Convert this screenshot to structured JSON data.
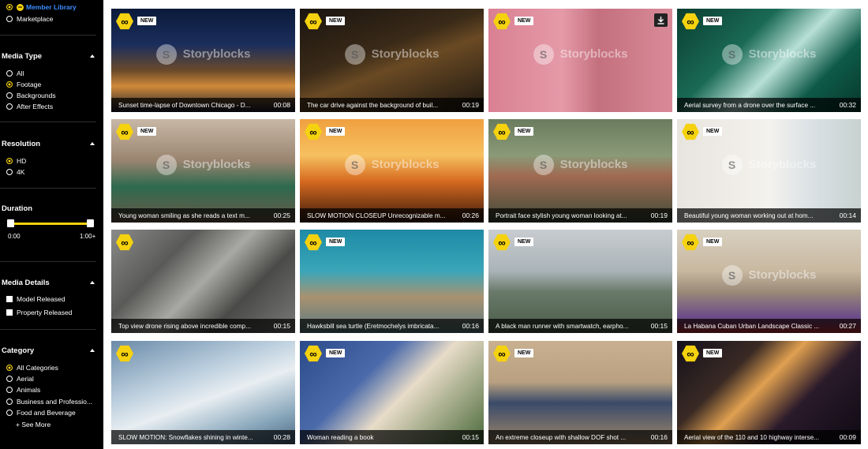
{
  "sidebar": {
    "library": [
      {
        "label": "Member Library",
        "selected": true
      },
      {
        "label": "Marketplace",
        "selected": false
      }
    ],
    "media_type": {
      "title": "Media Type",
      "options": [
        {
          "label": "All",
          "selected": false
        },
        {
          "label": "Footage",
          "selected": true
        },
        {
          "label": "Backgrounds",
          "selected": false
        },
        {
          "label": "After Effects",
          "selected": false
        }
      ]
    },
    "resolution": {
      "title": "Resolution",
      "options": [
        {
          "label": "HD",
          "selected": true
        },
        {
          "label": "4K",
          "selected": false
        }
      ]
    },
    "duration": {
      "title": "Duration",
      "min_label": "0:00",
      "max_label": "1:00+",
      "range": [
        0,
        1
      ]
    },
    "media_details": {
      "title": "Media Details",
      "options": [
        {
          "label": "Model Released",
          "checked": false
        },
        {
          "label": "Property Released",
          "checked": false
        }
      ]
    },
    "category": {
      "title": "Category",
      "options": [
        {
          "label": "All Categories",
          "selected": true
        },
        {
          "label": "Aerial",
          "selected": false
        },
        {
          "label": "Animals",
          "selected": false
        },
        {
          "label": "Business and Professio...",
          "selected": false
        },
        {
          "label": "Food and Beverage",
          "selected": false
        }
      ],
      "see_more": "+ See More"
    }
  },
  "watermark_text": "Storyblocks",
  "new_label": "NEW",
  "colors": {
    "accent": "#f5d20f",
    "link": "#3b8cff"
  },
  "clips": [
    {
      "title": "Sunset time-lapse of Downtown Chicago - D...",
      "duration": "00:08",
      "new": true,
      "watermark": true,
      "download": false,
      "bg": "linear-gradient(180deg,#0b1a3a 0%,#1b2e5c 35%,#6b4a2a 60%,#d08a3a 75%,#1a1a2a 100%)"
    },
    {
      "title": "The car drive against the background of buil...",
      "duration": "00:19",
      "new": true,
      "watermark": true,
      "download": false,
      "bg": "linear-gradient(160deg,#1a1410 0%,#3a2a18 40%,#6a4a24 55%,#1c1610 100%)"
    },
    {
      "title": "",
      "duration": "",
      "new": true,
      "watermark": true,
      "download": true,
      "bg": "linear-gradient(90deg,#d98092 0%,#e59aa8 40%,#c4707e 60%,#d98a98 100%)"
    },
    {
      "title": "Aerial survey from a drone over the surface ...",
      "duration": "00:32",
      "new": true,
      "watermark": true,
      "download": false,
      "bg": "linear-gradient(135deg,#0a3d30 0%,#1a6a55 35%,#b8e0d6 55%,#0e5a48 75%,#07382c 100%)"
    },
    {
      "title": "Young woman smiling as she reads a text m...",
      "duration": "00:25",
      "new": true,
      "watermark": true,
      "download": false,
      "bg": "linear-gradient(180deg,#c8b8a6 0%,#9a8470 40%,#2e6a4e 65%,#6a5848 100%)"
    },
    {
      "title": "SLOW MOTION CLOSEUP Unrecognizable m...",
      "duration": "00:26",
      "new": true,
      "watermark": true,
      "download": false,
      "bg": "linear-gradient(180deg,#f0a040 0%,#f6c060 35%,#d66a20 60%,#3a1a0a 100%)"
    },
    {
      "title": "Portrait face stylish young woman looking at...",
      "duration": "00:19",
      "new": true,
      "watermark": true,
      "download": false,
      "bg": "linear-gradient(180deg,#6a7c5e 0%,#8a9a78 35%,#a06a52 55%,#3e4a36 100%)"
    },
    {
      "title": "Beautiful young woman working out at hom...",
      "duration": "00:14",
      "new": true,
      "watermark": true,
      "download": false,
      "bg": "linear-gradient(90deg,#e8e4de 0%,#f4f2ee 50%,#d8e0e4 75%,#c8d2d0 100%)"
    },
    {
      "title": "Top view drone rising above incredible comp...",
      "duration": "00:15",
      "new": false,
      "watermark": false,
      "download": false,
      "bg": "linear-gradient(135deg,#8a8a88 0%,#5a5a58 30%,#a8a8a4 50%,#4a4a48 70%,#7a7a78 100%)"
    },
    {
      "title": "Hawksbill sea turtle (Eretmochelys imbricata...",
      "duration": "00:16",
      "new": true,
      "watermark": false,
      "download": false,
      "bg": "linear-gradient(180deg,#1e8aa6 0%,#3aa6b8 40%,#a89270 65%,#5a7a80 100%)"
    },
    {
      "title": "A black man runner with smartwatch, earpho...",
      "duration": "00:15",
      "new": true,
      "watermark": false,
      "download": false,
      "bg": "linear-gradient(180deg,#c8ccd0 0%,#aab4b8 40%,#6a7a6a 60%,#4a5a48 100%)"
    },
    {
      "title": "La Habana Cuban Urban Landscape Classic ...",
      "duration": "00:27",
      "new": true,
      "watermark": true,
      "download": false,
      "bg": "linear-gradient(180deg,#d8d0c0 0%,#c8b8a0 40%,#9a8a78 60%,#6a4a8a 85%,#c83030 100%)"
    },
    {
      "title": "SLOW MOTION: Snowflakes shining in winte...",
      "duration": "00:28",
      "new": false,
      "watermark": false,
      "download": false,
      "bg": "linear-gradient(160deg,#6a8aa8 0%,#b8ccdc 35%,#e8eef2 55%,#8aa8bc 80%,#4a6a84 100%)"
    },
    {
      "title": "Woman reading a book",
      "duration": "00:15",
      "new": true,
      "watermark": false,
      "download": false,
      "bg": "linear-gradient(135deg,#2a4a8a 0%,#4a6aaa 35%,#e8dcc8 55%,#4a6a3a 100%)"
    },
    {
      "title": "An extreme closeup with shallow DOF shot ...",
      "duration": "00:16",
      "new": true,
      "watermark": false,
      "download": false,
      "bg": "linear-gradient(180deg,#c8b090 0%,#b8a080 40%,#3a4a6a 60%,#a08868 100%)"
    },
    {
      "title": "Aerial view of the 110 and 10 highway interse...",
      "duration": "00:09",
      "new": true,
      "watermark": false,
      "download": false,
      "bg": "linear-gradient(135deg,#14101c 0%,#3a2a24 30%,#e0a050 45%,#2a1a2a 65%,#0e0a14 100%)"
    }
  ]
}
